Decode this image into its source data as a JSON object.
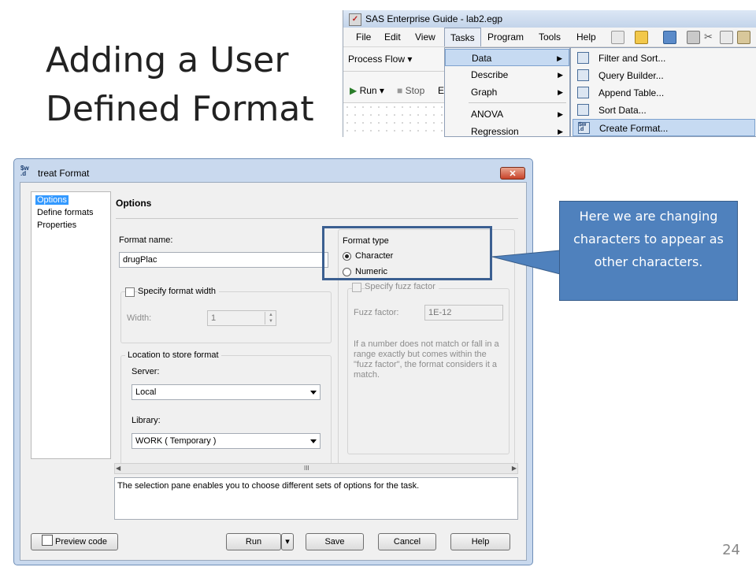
{
  "slide": {
    "title_line1": "Adding a User",
    "title_line2": "Defined Format",
    "page_number": "24"
  },
  "eg": {
    "window_title": "SAS Enterprise Guide - lab2.egp",
    "menus": [
      "File",
      "Edit",
      "View",
      "Tasks",
      "Program",
      "Tools",
      "Help"
    ],
    "process_flow": "Process Flow",
    "run": "Run",
    "stop": "Stop",
    "cut_letter": "E",
    "tasks_menu": [
      {
        "label": "Data",
        "selected": true
      },
      {
        "label": "Describe"
      },
      {
        "label": "Graph"
      },
      {
        "label": "ANOVA"
      },
      {
        "label": "Regression"
      }
    ],
    "data_submenu": [
      {
        "label": "Filter and Sort...",
        "icon": "filter-sort-icon"
      },
      {
        "label": "Query Builder...",
        "icon": "query-builder-icon"
      },
      {
        "label": "Append Table...",
        "icon": "append-table-icon"
      },
      {
        "label": "Sort Data...",
        "icon": "sort-data-icon"
      },
      {
        "label": "Create Format...",
        "icon": "create-format-icon",
        "selected": true
      }
    ]
  },
  "dialog": {
    "title": "treat Format",
    "icon_text": "$w.d",
    "nav": [
      {
        "label": "Options",
        "selected": true
      },
      {
        "label": "Define formats"
      },
      {
        "label": "Properties"
      }
    ],
    "pane_title": "Options",
    "format_name_label": "Format name:",
    "format_name_value": "drugPlac",
    "format_type": {
      "legend": "Format type",
      "options": [
        {
          "label": "Character",
          "checked": true
        },
        {
          "label": "Numeric",
          "checked": false
        }
      ]
    },
    "width_group": {
      "checkbox_label": "Specify format width",
      "width_label": "Width:",
      "width_value": "1"
    },
    "fuzz_group": {
      "checkbox_label": "Specify fuzz factor",
      "fuzz_label": "Fuzz factor:",
      "fuzz_value": "1E-12",
      "note": "If a number does not match or fall in a range exactly but comes within the \"fuzz factor\", the format considers it a match."
    },
    "location": {
      "legend": "Location to store format",
      "server_label": "Server:",
      "server_value": "Local",
      "library_label": "Library:",
      "library_value": "WORK ( Temporary )"
    },
    "scroll_grip": "III",
    "description": "The selection pane enables you to choose different sets of options for the task.",
    "buttons": {
      "preview": "Preview code",
      "run": "Run",
      "save": "Save",
      "cancel": "Cancel",
      "help": "Help"
    }
  },
  "callout": {
    "text": "Here we are changing characters to appear as other characters."
  },
  "colors": {
    "callout_fill": "#4f81bd",
    "highlight_border": "#3b5f91",
    "selection_blue": "#3399ff",
    "menu_highlight": "#c6daf2"
  }
}
